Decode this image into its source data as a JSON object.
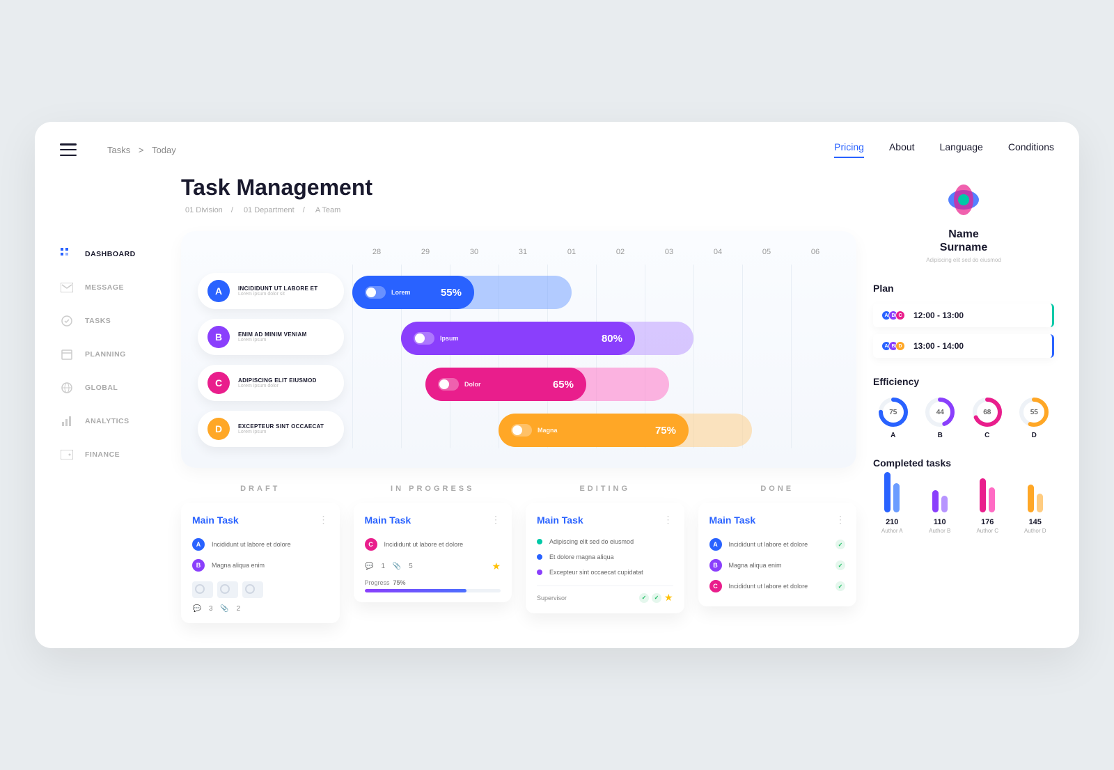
{
  "breadcrumb": {
    "a": "Tasks",
    "b": "Today"
  },
  "nav": {
    "pricing": "Pricing",
    "about": "About",
    "language": "Language",
    "conditions": "Conditions"
  },
  "title": "Task Management",
  "sub": {
    "a": "01 Division",
    "b": "01 Department",
    "c": "A Team"
  },
  "sidebar": {
    "dashboard": "DASHBOARD",
    "message": "MESSAGE",
    "tasks": "TASKS",
    "planning": "PLANNING",
    "global": "GLOBAL",
    "analytics": "ANALYTICS",
    "finance": "FINANCE"
  },
  "gantt": {
    "days": [
      "28",
      "29",
      "30",
      "31",
      "01",
      "02",
      "03",
      "04",
      "05",
      "06"
    ],
    "tasks": [
      {
        "letter": "A",
        "title": "INCIDIDUNT UT LABORE ET",
        "sub": "Lorem ipsum dolor sit",
        "bar_label": "Lorem",
        "percent": "55%"
      },
      {
        "letter": "B",
        "title": "ENIM AD MINIM VENIAM",
        "sub": "Lorem ipsum",
        "bar_label": "Ipsum",
        "percent": "80%"
      },
      {
        "letter": "C",
        "title": "ADIPISCING ELIT EIUSMOD",
        "sub": "Lorem ipsum dolor",
        "bar_label": "Dolor",
        "percent": "65%"
      },
      {
        "letter": "D",
        "title": "EXCEPTEUR SINT OCCAECAT",
        "sub": "Lorem ipsum",
        "bar_label": "Magna",
        "percent": "75%"
      }
    ]
  },
  "kanban": {
    "cols": {
      "draft": "DRAFT",
      "progress": "IN PROGRESS",
      "editing": "EDITING",
      "done": "DONE"
    },
    "card_title": "Main Task",
    "draft": {
      "i1": "Incididunt ut labore et dolore",
      "i2": "Magna aliqua enim",
      "comments": "3",
      "attach": "2"
    },
    "progress": {
      "i1": "Incididunt ut labore et dolore",
      "comments": "1",
      "attach": "5",
      "progress_label": "Progress",
      "progress_pct": "75%"
    },
    "editing": {
      "i1": "Adipiscing elit sed do eiusmod",
      "i2": "Et dolore magna aliqua",
      "i3": "Excepteur sint occaecat cupidatat",
      "supervisor": "Supervisor"
    },
    "done": {
      "i1": "Incididunt ut labore et dolore",
      "i2": "Magna aliqua enim",
      "i3": "Incididunt ut labore et dolore"
    }
  },
  "profile": {
    "name1": "Name",
    "name2": "Surname",
    "sub": "Adipiscing elit sed do eiusmod"
  },
  "plan": {
    "title": "Plan",
    "items": [
      {
        "time": "12:00 - 13:00",
        "avatars": [
          "A",
          "B",
          "C"
        ]
      },
      {
        "time": "13:00 - 14:00",
        "avatars": [
          "A",
          "B",
          "D"
        ]
      }
    ]
  },
  "efficiency": {
    "title": "Efficiency",
    "items": [
      {
        "val": "75",
        "label": "A"
      },
      {
        "val": "44",
        "label": "B"
      },
      {
        "val": "68",
        "label": "C"
      },
      {
        "val": "55",
        "label": "D"
      }
    ]
  },
  "completed": {
    "title": "Completed tasks",
    "items": [
      {
        "val": "210",
        "label": "Author A"
      },
      {
        "val": "110",
        "label": "Author B"
      },
      {
        "val": "176",
        "label": "Author C"
      },
      {
        "val": "145",
        "label": "Author D"
      }
    ]
  },
  "chart_data": {
    "gantt": {
      "type": "gantt",
      "days": [
        "28",
        "29",
        "30",
        "31",
        "01",
        "02",
        "03",
        "04",
        "05",
        "06"
      ],
      "bars": [
        {
          "id": "A",
          "label": "Lorem",
          "start": 0,
          "end_bg": 4.5,
          "end_fill": 2.5,
          "percent": 55,
          "color": "#2962ff"
        },
        {
          "id": "B",
          "label": "Ipsum",
          "start": 1,
          "end_bg": 7.0,
          "end_fill": 5.8,
          "percent": 80,
          "color": "#8a3ffc"
        },
        {
          "id": "C",
          "label": "Dolor",
          "start": 1.5,
          "end_bg": 6.5,
          "end_fill": 4.8,
          "percent": 65,
          "color": "#e91e8c"
        },
        {
          "id": "D",
          "label": "Magna",
          "start": 3,
          "end_bg": 8.2,
          "end_fill": 6.9,
          "percent": 75,
          "color": "#ffa726"
        }
      ]
    },
    "efficiency_donuts": {
      "type": "pie",
      "series": [
        {
          "name": "A",
          "values": [
            75,
            25
          ],
          "color": "#2962ff"
        },
        {
          "name": "B",
          "values": [
            44,
            56
          ],
          "color": "#8a3ffc"
        },
        {
          "name": "C",
          "values": [
            68,
            32
          ],
          "color": "#e91e8c"
        },
        {
          "name": "D",
          "values": [
            55,
            45
          ],
          "color": "#ffa726"
        }
      ]
    },
    "completed_bars": {
      "type": "bar",
      "categories": [
        "Author A",
        "Author B",
        "Author C",
        "Author D"
      ],
      "series": [
        {
          "name": "primary",
          "values": [
            210,
            110,
            176,
            145
          ]
        },
        {
          "name": "secondary",
          "values": [
            150,
            85,
            130,
            95
          ]
        }
      ],
      "ylim": [
        0,
        220
      ],
      "colors": [
        "#2962ff",
        "#8a3ffc",
        "#e91e8c",
        "#ffa726"
      ]
    }
  }
}
